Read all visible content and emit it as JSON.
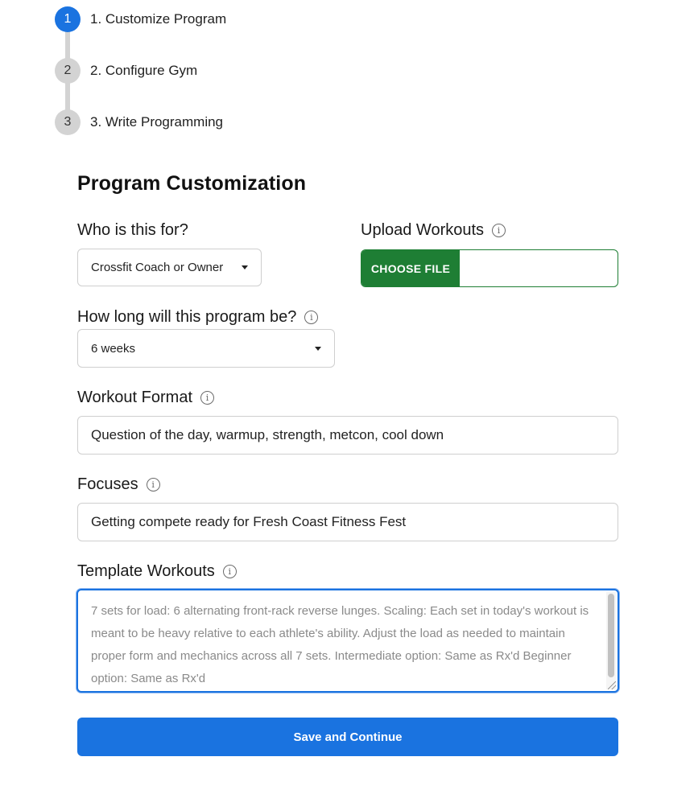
{
  "stepper": {
    "steps": [
      {
        "number": "1",
        "label": "1. Customize Program",
        "active": true
      },
      {
        "number": "2",
        "label": "2. Configure Gym",
        "active": false
      },
      {
        "number": "3",
        "label": "3. Write Programming",
        "active": false
      }
    ]
  },
  "form": {
    "title": "Program Customization",
    "who": {
      "label": "Who is this for?",
      "value": "Crossfit Coach or Owner"
    },
    "upload": {
      "label": "Upload Workouts",
      "button_label": "CHOOSE FILE"
    },
    "length": {
      "label": "How long will this program be?",
      "value": "6 weeks"
    },
    "format": {
      "label": "Workout Format",
      "value": "Question of the day, warmup, strength, metcon, cool down"
    },
    "focuses": {
      "label": "Focuses",
      "value": "Getting compete ready for Fresh Coast Fitness Fest"
    },
    "template": {
      "label": "Template Workouts",
      "placeholder": "7 sets for load: 6 alternating front-rack reverse lunges. Scaling: Each set in today's workout is meant to be heavy relative to each athlete's ability. Adjust the load as needed to maintain proper form and mechanics across all 7 sets. Intermediate option: Same as Rx'd Beginner option: Same as Rx'd"
    },
    "save_label": "Save and Continue"
  },
  "icons": {
    "info": "info-icon",
    "dropdown": "chevron-down-icon"
  },
  "colors": {
    "primary": "#1a73e0",
    "upload_green": "#1e7e34",
    "step_inactive": "#d3d3d3"
  }
}
